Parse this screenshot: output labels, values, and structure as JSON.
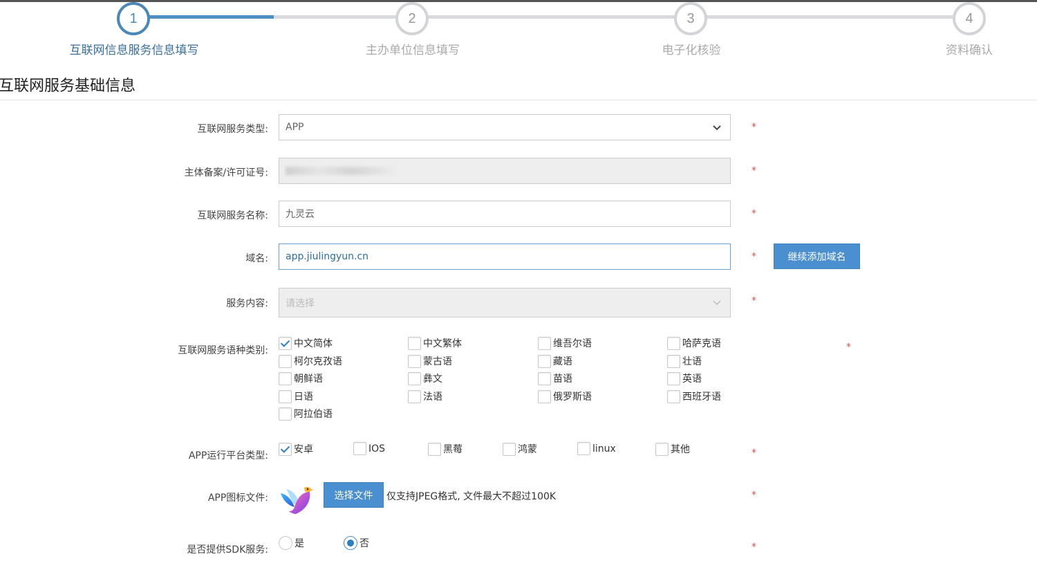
{
  "steps": [
    {
      "number": "1",
      "label": "互联网信息服务信息填写"
    },
    {
      "number": "2",
      "label": "主办单位信息填写"
    },
    {
      "number": "3",
      "label": "电子化核验"
    },
    {
      "number": "4",
      "label": "资料确认"
    }
  ],
  "section_title": "互联网服务基础信息",
  "required_mark": "*",
  "form": {
    "service_type": {
      "label": "互联网服务类型:",
      "value": "APP"
    },
    "license_no": {
      "label": "主体备案/许可证号:"
    },
    "service_name": {
      "label": "互联网服务名称:",
      "value": "九灵云"
    },
    "domain": {
      "label": "域名:",
      "value": "app.jiulingyun.cn",
      "add_button": "继续添加域名"
    },
    "service_content": {
      "label": "服务内容:",
      "placeholder": "请选择"
    },
    "languages": {
      "label": "互联网服务语种类别:",
      "options": [
        {
          "label": "中文简体",
          "checked": true
        },
        {
          "label": "中文繁体",
          "checked": false
        },
        {
          "label": "维吾尔语",
          "checked": false
        },
        {
          "label": "哈萨克语",
          "checked": false
        },
        {
          "label": "柯尔克孜语",
          "checked": false
        },
        {
          "label": "蒙古语",
          "checked": false
        },
        {
          "label": "藏语",
          "checked": false
        },
        {
          "label": "壮语",
          "checked": false
        },
        {
          "label": "朝鲜语",
          "checked": false
        },
        {
          "label": "彝文",
          "checked": false
        },
        {
          "label": "苗语",
          "checked": false
        },
        {
          "label": "英语",
          "checked": false
        },
        {
          "label": "日语",
          "checked": false
        },
        {
          "label": "法语",
          "checked": false
        },
        {
          "label": "俄罗斯语",
          "checked": false
        },
        {
          "label": "西班牙语",
          "checked": false
        },
        {
          "label": "阿拉伯语",
          "checked": false
        }
      ]
    },
    "platforms": {
      "label": "APP运行平台类型:",
      "options": [
        {
          "label": "安卓",
          "checked": true
        },
        {
          "label": "IOS",
          "checked": false
        },
        {
          "label": "黑莓",
          "checked": false
        },
        {
          "label": "鸿蒙",
          "checked": false
        },
        {
          "label": "linux",
          "checked": false
        },
        {
          "label": "其他",
          "checked": false
        }
      ]
    },
    "app_icon": {
      "label": "APP图标文件:",
      "button": "选择文件",
      "hint": "仅支持JPEG格式, 文件最大不超过100K"
    },
    "sdk": {
      "label": "是否提供SDK服务:",
      "options": [
        {
          "label": "是",
          "checked": false
        },
        {
          "label": "否",
          "checked": true
        }
      ]
    }
  },
  "colors": {
    "accent": "#4a8fcf",
    "required": "#d9534f",
    "step_active": "#4a88ba"
  }
}
